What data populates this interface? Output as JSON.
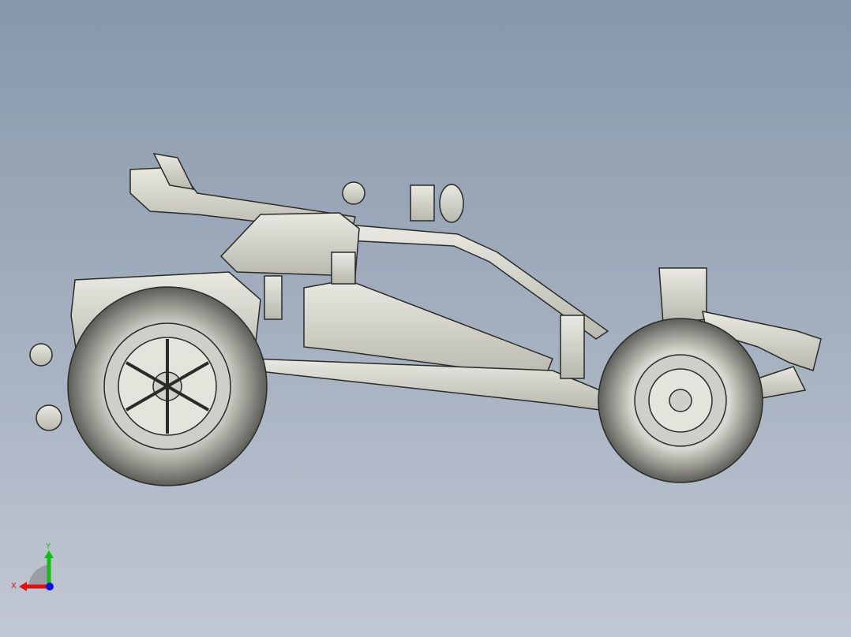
{
  "viewport": {
    "model": "technic-buggy-side-view",
    "background_top": "#8797ab",
    "background_bottom": "#c1c8d3"
  },
  "triad": {
    "x_label": "X",
    "y_label": "Y",
    "x_color": "#e01010",
    "y_color": "#10c010",
    "z_color": "#1010e0"
  }
}
